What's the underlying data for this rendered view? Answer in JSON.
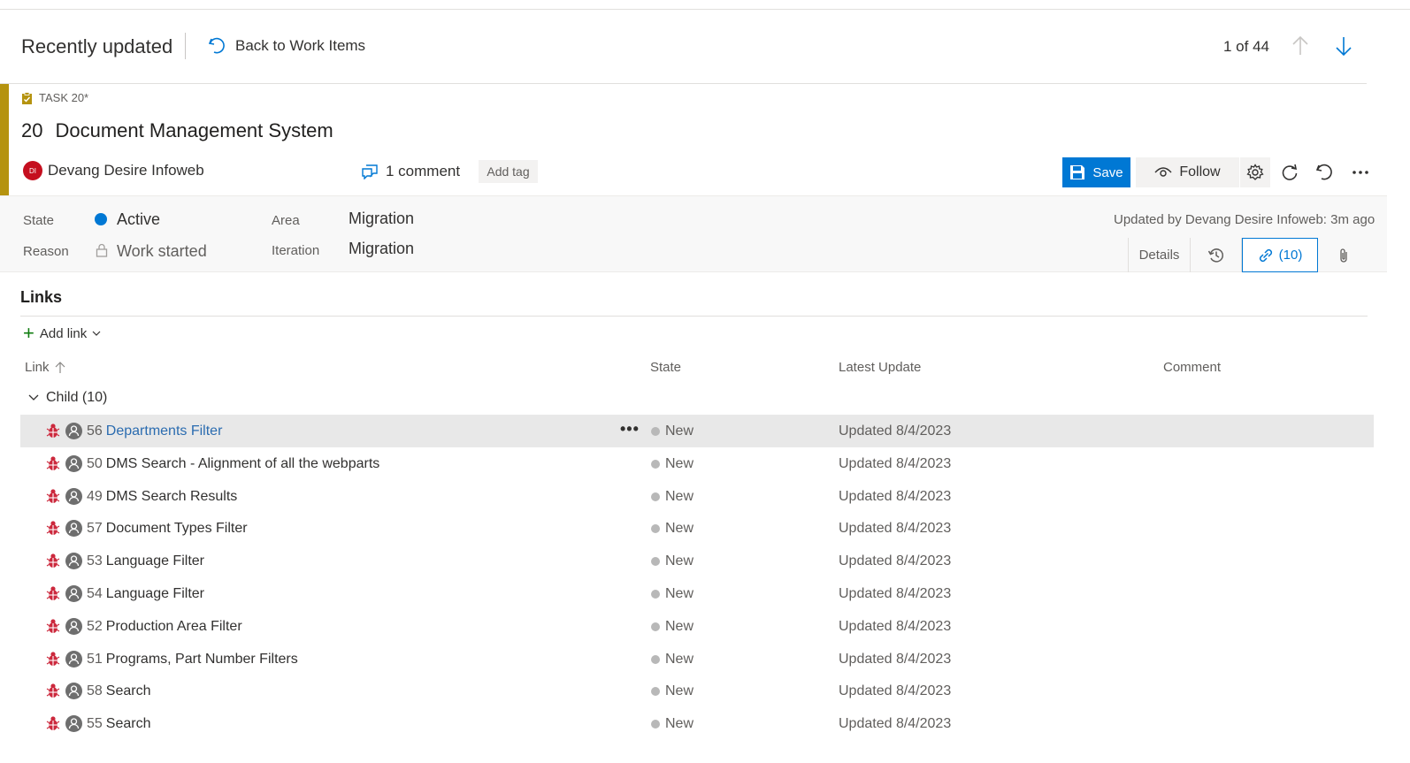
{
  "header": {
    "page_title": "Recently updated",
    "back_label": "Back to Work Items",
    "pager": "1 of 44"
  },
  "work_item": {
    "type_label": "TASK 20*",
    "id": "20",
    "title": "Document Management System",
    "assignee_initials": "DI",
    "assignee": "Devang Desire Infoweb",
    "comments": "1 comment",
    "add_tag": "Add tag",
    "save_label": "Save",
    "follow_label": "Follow",
    "accent_color": "#b5930f"
  },
  "fields": {
    "state_label": "State",
    "state_value": "Active",
    "reason_label": "Reason",
    "reason_value": "Work started",
    "area_label": "Area",
    "area_value": "Migration",
    "iteration_label": "Iteration",
    "iteration_value": "Migration",
    "updated_by": "Updated by Devang Desire Infoweb: 3m ago"
  },
  "tabs": {
    "details": "Details",
    "links": "(10)"
  },
  "links": {
    "section_title": "Links",
    "add_link": "Add link",
    "columns": {
      "link": "Link",
      "state": "State",
      "latest_update": "Latest Update",
      "comment": "Comment"
    },
    "group_label": "Child (10)",
    "rows": [
      {
        "id": "56",
        "name": "Departments Filter",
        "state": "New",
        "updated": "Updated 8/4/2023"
      },
      {
        "id": "50",
        "name": "DMS Search - Alignment of all the webparts",
        "state": "New",
        "updated": "Updated 8/4/2023"
      },
      {
        "id": "49",
        "name": "DMS Search Results",
        "state": "New",
        "updated": "Updated 8/4/2023"
      },
      {
        "id": "57",
        "name": "Document Types Filter",
        "state": "New",
        "updated": "Updated 8/4/2023"
      },
      {
        "id": "53",
        "name": "Language Filter",
        "state": "New",
        "updated": "Updated 8/4/2023"
      },
      {
        "id": "54",
        "name": "Language Filter",
        "state": "New",
        "updated": "Updated 8/4/2023"
      },
      {
        "id": "52",
        "name": "Production Area Filter",
        "state": "New",
        "updated": "Updated 8/4/2023"
      },
      {
        "id": "51",
        "name": "Programs, Part Number Filters",
        "state": "New",
        "updated": "Updated 8/4/2023"
      },
      {
        "id": "58",
        "name": "Search",
        "state": "New",
        "updated": "Updated 8/4/2023"
      },
      {
        "id": "55",
        "name": "Search",
        "state": "New",
        "updated": "Updated 8/4/2023"
      }
    ]
  }
}
